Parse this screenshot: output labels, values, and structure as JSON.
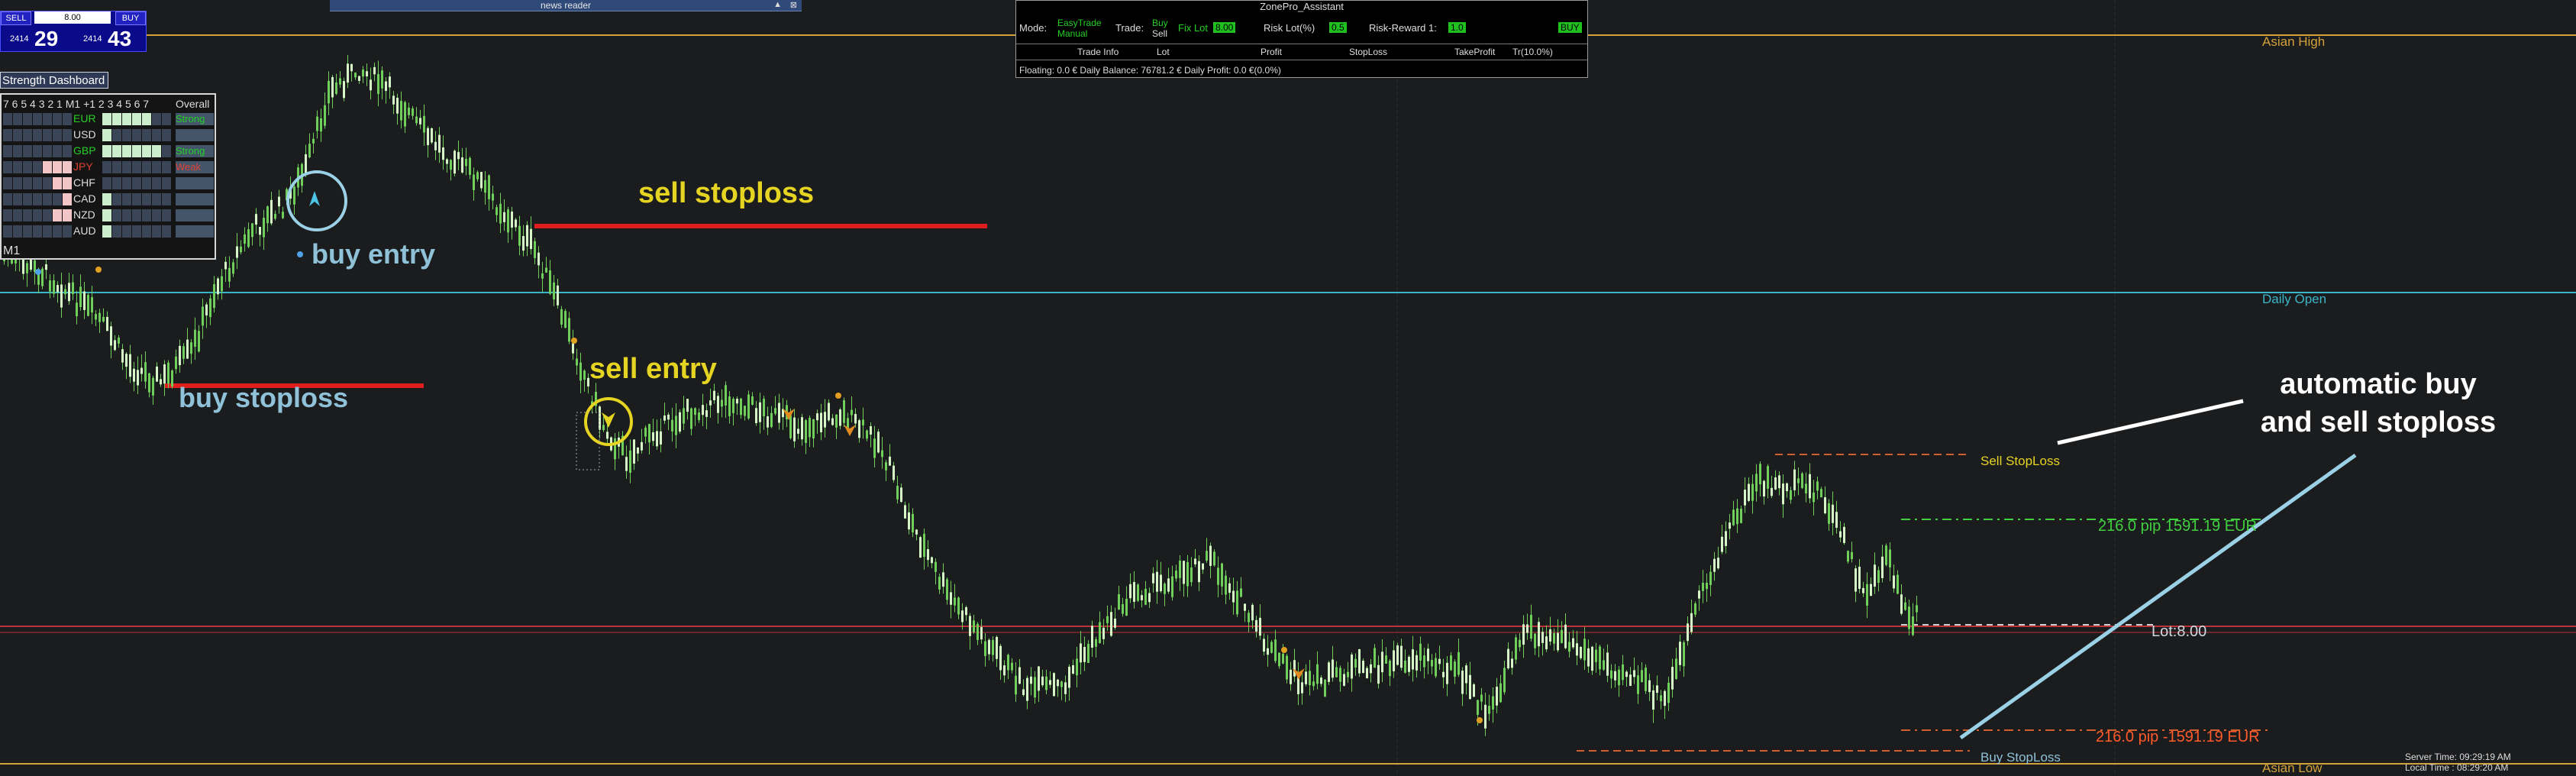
{
  "trade_panel": {
    "sell_label": "SELL",
    "buy_label": "BUY",
    "lot_value": "8.00",
    "sell_price_prefix": "2414",
    "sell_price_big": "29",
    "buy_price_prefix": "2414",
    "buy_price_big": "43"
  },
  "news_reader": {
    "title": "news reader"
  },
  "zonepro": {
    "title": "ZonePro_Assistant",
    "mode_label": "Mode:",
    "mode_line1": "EasyTrade",
    "mode_line2": "Manual",
    "trade_label": "Trade:",
    "trade_buy": "Buy",
    "trade_sell": "Sell",
    "fix_lot_label": "Fix Lot",
    "fix_lot_value": "8.00",
    "risk_lot_label": "Risk Lot(%)",
    "risk_lot_value": "0.5",
    "rr_label": "Risk-Reward 1:",
    "rr_value": "1.0",
    "action_value": "BUY",
    "info_headers": [
      "Trade Info",
      "Lot",
      "Profit",
      "StopLoss",
      "TakeProfit",
      "Tr(10.0%)"
    ],
    "status": "Floating: 0.0 €  Daily Balance: 76781.2 €  Daily Profit: 0.0 €(0.0%)"
  },
  "strength_dashboard": {
    "title": "Strength Dashboard",
    "header_left": "7 6 5 4 3 2 1 M1 +1 2 3 4 5 6 7",
    "header_overall": "Overall",
    "timeframe": "M1",
    "rows": [
      {
        "currency": "EUR",
        "status": "Strong",
        "left_pink": 0,
        "right_green": 5,
        "color": "#24d024"
      },
      {
        "currency": "USD",
        "status": "",
        "left_pink": 0,
        "right_green": 1,
        "color": "#dddddd"
      },
      {
        "currency": "GBP",
        "status": "Strong",
        "left_pink": 0,
        "right_green": 6,
        "color": "#24d024"
      },
      {
        "currency": "JPY",
        "status": "Weak",
        "left_pink": 3,
        "right_green": 0,
        "color": "#e04030"
      },
      {
        "currency": "CHF",
        "status": "",
        "left_pink": 2,
        "right_green": 0,
        "color": "#dddddd"
      },
      {
        "currency": "CAD",
        "status": "",
        "left_pink": 1,
        "right_green": 1,
        "color": "#dddddd"
      },
      {
        "currency": "NZD",
        "status": "",
        "left_pink": 2,
        "right_green": 1,
        "color": "#dddddd"
      },
      {
        "currency": "AUD",
        "status": "",
        "left_pink": 0,
        "right_green": 1,
        "color": "#dddddd"
      }
    ]
  },
  "annotations": {
    "buy_entry": "buy entry",
    "buy_stoploss": "buy stoploss",
    "sell_stoploss": "sell stoploss",
    "sell_entry": "sell entry",
    "auto_line1": "automatic buy",
    "auto_line2": "and sell stoploss"
  },
  "levels": {
    "asian_high": "Asian High",
    "daily_open": "Daily Open",
    "asian_low": "Asian Low",
    "sell_stoploss": "Sell StopLoss",
    "buy_stoploss": "Buy StopLoss",
    "tp_profit": "216.0 pip 1591.19 EUR",
    "sl_loss": "216.0 pip -1591.19 EUR",
    "lot": "Lot:8.00"
  },
  "server_time": "Server Time: 09:29:19 AM",
  "local_time": "Local Time  : 08:29:20 AM",
  "colors": {
    "background": "#1b1c1e",
    "candle": "#7ee06a",
    "asian_line": "#d4a23a",
    "daily_open": "#3bb6c9",
    "red_line": "#e01e1e",
    "profit": "#3fcf3f",
    "loss": "#ff5a2a"
  }
}
